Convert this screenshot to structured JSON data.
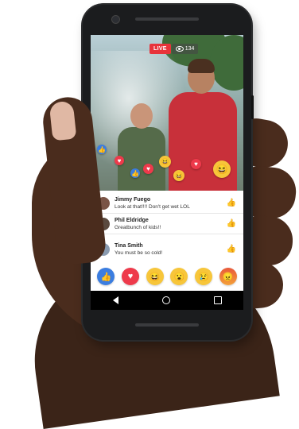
{
  "video": {
    "live_label": "LIVE",
    "viewer_count": "134"
  },
  "floating_reactions": [
    {
      "type": "like",
      "glyph": "👍"
    },
    {
      "type": "heart",
      "glyph": "♥"
    },
    {
      "type": "like",
      "glyph": "👍"
    },
    {
      "type": "heart",
      "glyph": "♥"
    },
    {
      "type": "haha",
      "glyph": "😆"
    },
    {
      "type": "haha",
      "glyph": "😆"
    },
    {
      "type": "heart",
      "glyph": "♥"
    },
    {
      "type": "haha",
      "glyph": "😆"
    }
  ],
  "comments": [
    {
      "name": "Jimmy Fuego",
      "text": "Look at that!!!!  Don't get wet LOL"
    },
    {
      "name": "Phil Eldridge",
      "text": "Greatbunch of kids!!"
    },
    {
      "name": "Tina Smith",
      "text": "You must be so cold!"
    }
  ],
  "reaction_bar": [
    {
      "name": "like",
      "glyph": "👍"
    },
    {
      "name": "love",
      "glyph": "♥"
    },
    {
      "name": "haha",
      "glyph": "😆"
    },
    {
      "name": "wow",
      "glyph": "😮"
    },
    {
      "name": "sad",
      "glyph": "😢"
    },
    {
      "name": "angry",
      "glyph": "😠"
    }
  ],
  "colors": {
    "live_red": "#e8333b",
    "like_blue": "#3b7de0",
    "love_red": "#ee3a4b",
    "emoji_yellow": "#f7c63a"
  }
}
